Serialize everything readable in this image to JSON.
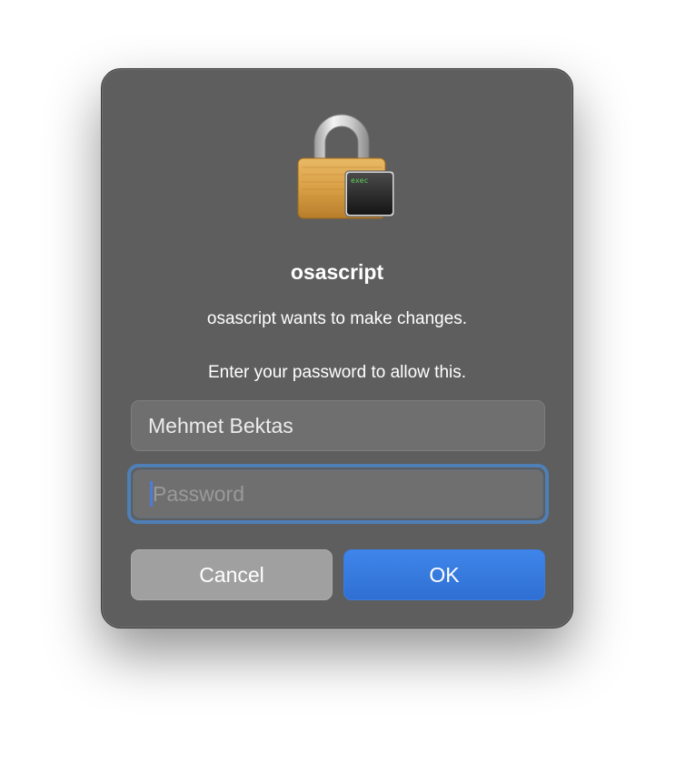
{
  "dialog": {
    "icon": "lock-with-exec-terminal-icon",
    "icon_badge_text": "exec",
    "title": "osascript",
    "message": "osascript wants to make changes.",
    "prompt": "Enter your password to allow this."
  },
  "fields": {
    "username_value": "Mehmet Bektas",
    "password_placeholder": "Password",
    "password_value": ""
  },
  "buttons": {
    "cancel_label": "Cancel",
    "ok_label": "OK"
  },
  "colors": {
    "dialog_bg": "#5e5e5e",
    "ok_accent": "#3a7ce3",
    "focus_ring": "#4e7fb6"
  }
}
